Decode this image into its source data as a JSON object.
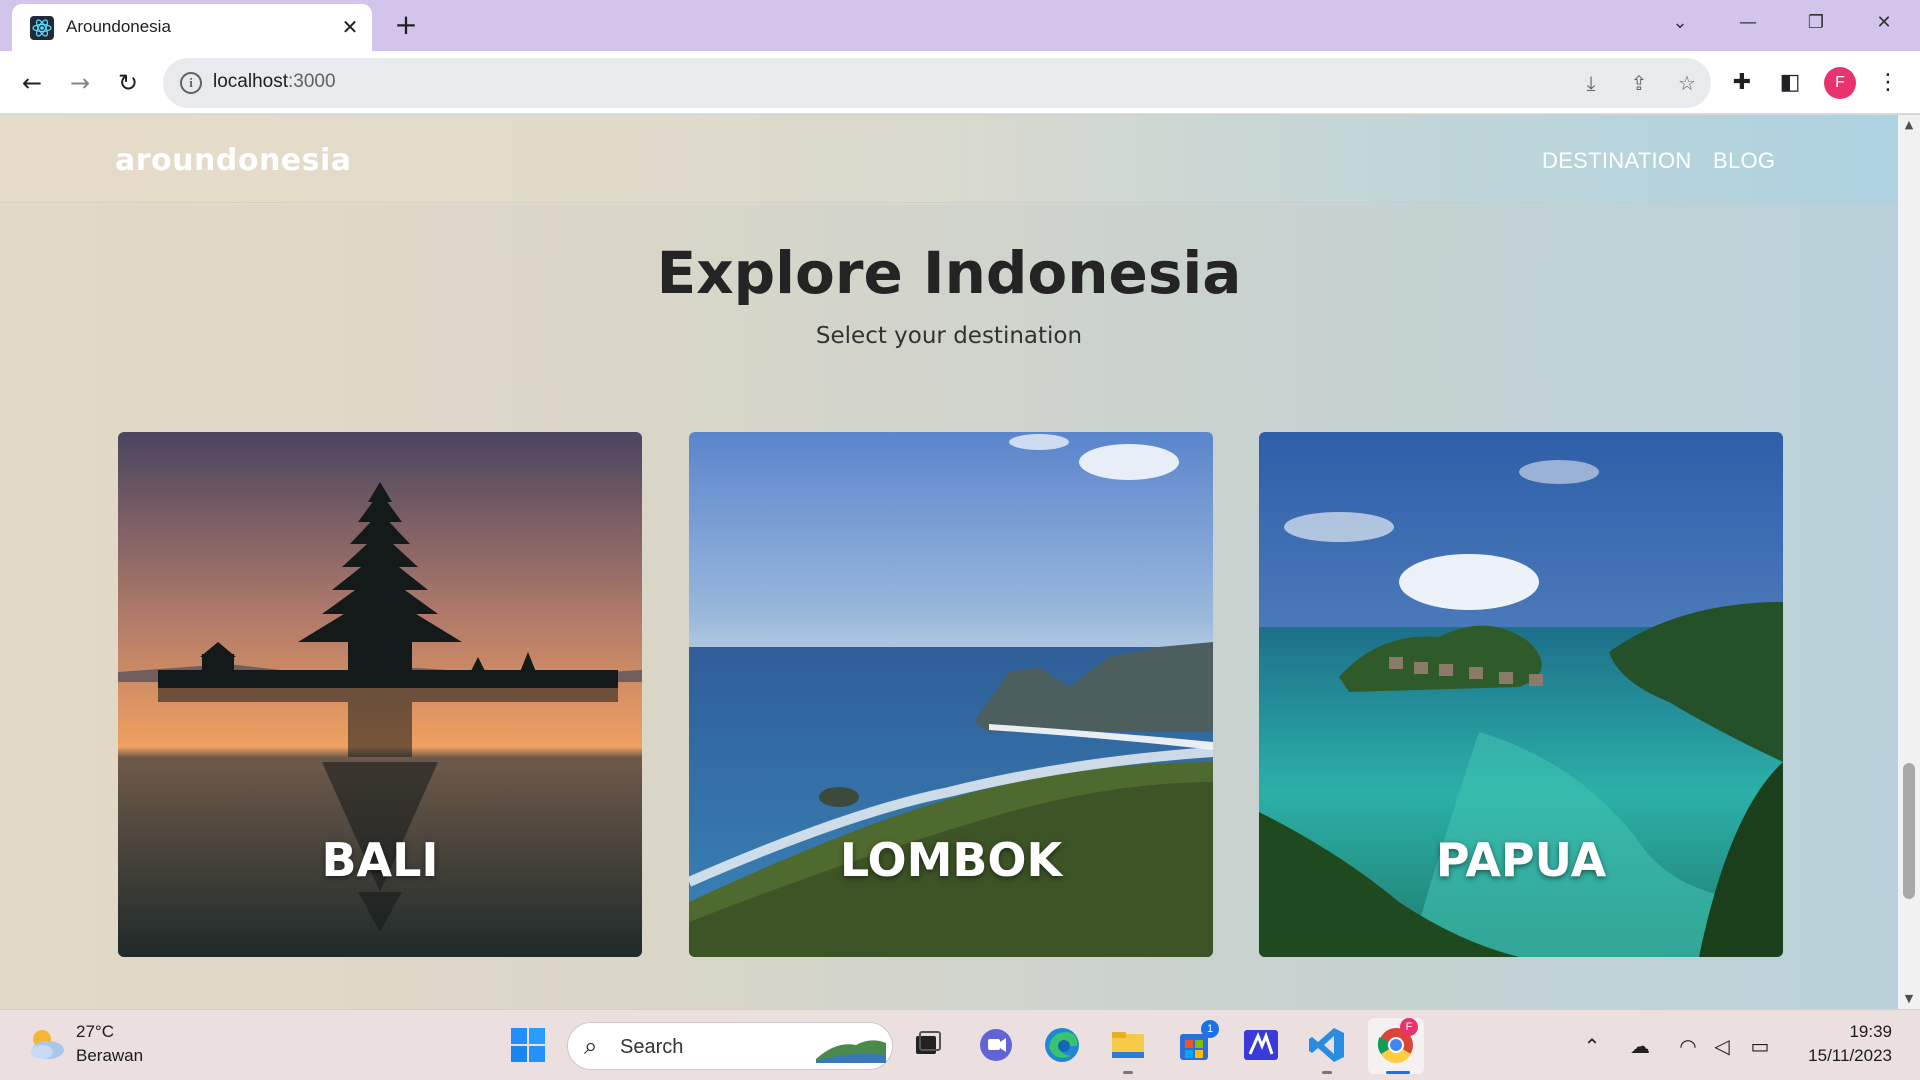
{
  "browser": {
    "tab_title": "Aroundonesia",
    "url_host": "localhost",
    "url_port": ":3000",
    "profile_initial": "F"
  },
  "site": {
    "logo": "aroundonesia",
    "nav": [
      {
        "label": "DESTINATION"
      },
      {
        "label": "BLOG"
      }
    ],
    "title": "Explore Indonesia",
    "subtitle": "Select your destination",
    "destinations": [
      {
        "label": "BALI"
      },
      {
        "label": "LOMBOK"
      },
      {
        "label": "PAPUA"
      }
    ]
  },
  "taskbar": {
    "weather_temp": "27°C",
    "weather_desc": "Berawan",
    "search_label": "Search",
    "store_badge": "1",
    "chrome_badge": "F",
    "time": "19:39",
    "date": "15/11/2023"
  },
  "colors": {
    "tabbar": "#d3c4ec",
    "profile": "#e8336e",
    "page_bg_left": "#e3d9c8",
    "page_bg_right": "#b9d1da"
  }
}
